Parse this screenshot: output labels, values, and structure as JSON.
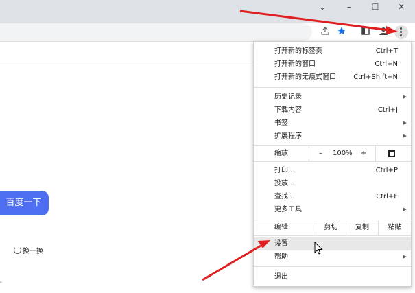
{
  "window": {
    "controls": {
      "dropdown": "⌄",
      "minimize": "–",
      "maximize": "☐",
      "close": "✕"
    }
  },
  "toolbar_icons": [
    "share-icon",
    "star-icon",
    "sidebar-icon",
    "profile-icon",
    "menu-icon"
  ],
  "page": {
    "search_button": "百度一下",
    "refresh_label": "换一换",
    "tiny_mark": "\""
  },
  "menu": {
    "group1": [
      {
        "label": "打开新的标签页",
        "shortcut": "Ctrl+T"
      },
      {
        "label": "打开新的窗口",
        "shortcut": "Ctrl+N"
      },
      {
        "label": "打开新的无痕式窗口",
        "shortcut": "Ctrl+Shift+N"
      }
    ],
    "group2": [
      {
        "label": "历史记录",
        "shortcut": "",
        "submenu": true
      },
      {
        "label": "下载内容",
        "shortcut": "Ctrl+J"
      },
      {
        "label": "书签",
        "shortcut": "",
        "submenu": true
      },
      {
        "label": "扩展程序",
        "shortcut": "",
        "submenu": true
      }
    ],
    "zoom": {
      "label": "缩放",
      "minus": "–",
      "value": "100%",
      "plus": "+"
    },
    "group3": [
      {
        "label": "打印...",
        "shortcut": "Ctrl+P"
      },
      {
        "label": "投放...",
        "shortcut": ""
      },
      {
        "label": "查找...",
        "shortcut": "Ctrl+F"
      },
      {
        "label": "更多工具",
        "shortcut": "",
        "submenu": true
      }
    ],
    "edit": {
      "label": "编辑",
      "cut": "剪切",
      "copy": "复制",
      "paste": "粘贴"
    },
    "group4": [
      {
        "label": "设置",
        "shortcut": "",
        "highlighted": true
      },
      {
        "label": "帮助",
        "shortcut": "",
        "submenu": true
      }
    ],
    "exit": {
      "label": "退出"
    }
  },
  "colors": {
    "accent": "#4e6ef2",
    "arrow": "#e02020",
    "star": "#1a73e8"
  }
}
